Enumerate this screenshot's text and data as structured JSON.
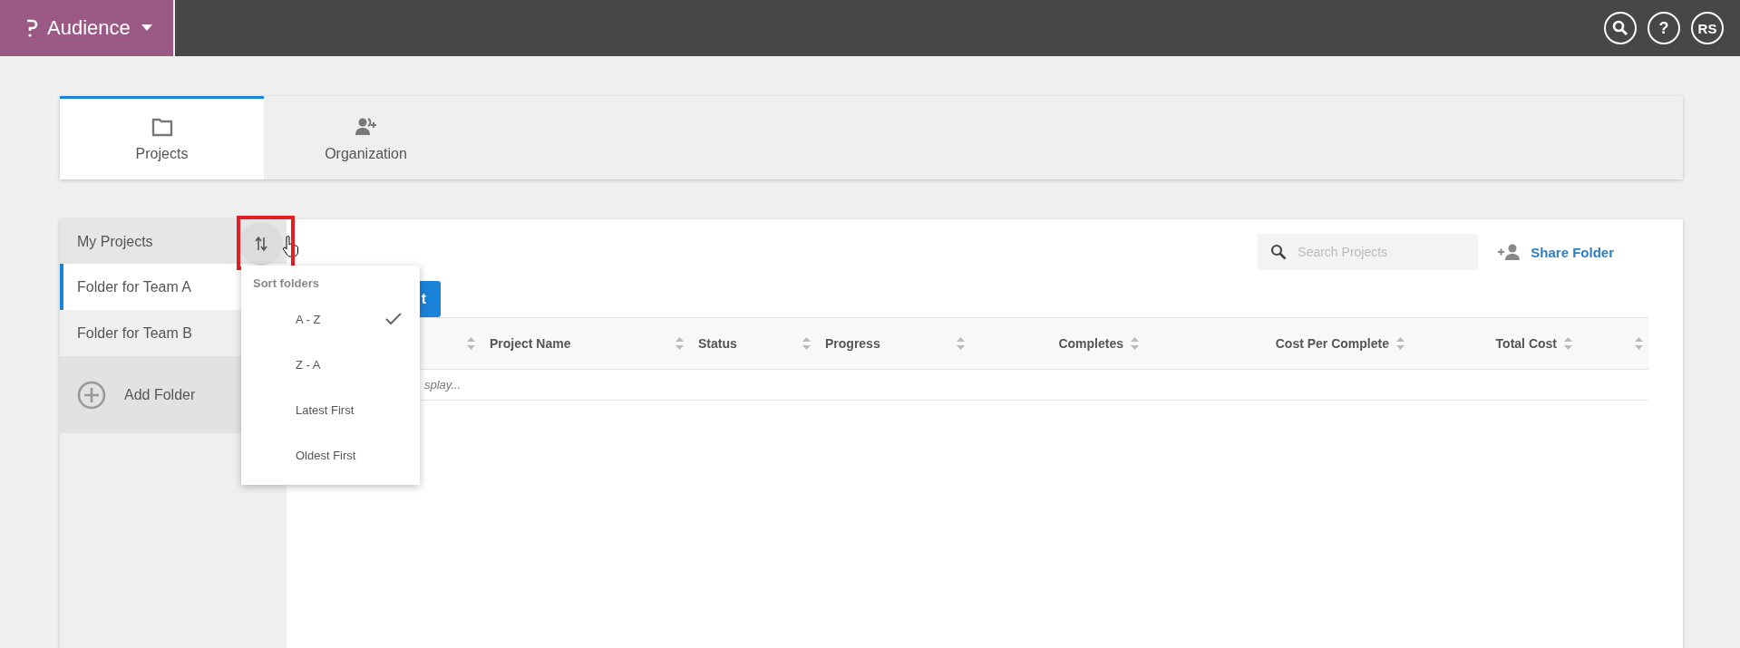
{
  "app": {
    "name": "Audience"
  },
  "header_actions": [
    {
      "kind": "search"
    },
    {
      "kind": "help",
      "label": "?"
    },
    {
      "kind": "avatar",
      "label": "RS"
    }
  ],
  "tabs": [
    {
      "label": "Projects",
      "selected": true
    },
    {
      "label": "Organization",
      "selected": false
    }
  ],
  "sidebar": {
    "header": "My Projects",
    "folders": [
      {
        "label": "Folder for Team A",
        "selected": true
      },
      {
        "label": "Folder for Team B",
        "selected": false
      }
    ],
    "add_folder": "Add Folder"
  },
  "sort_menu": {
    "title": "Sort folders",
    "options": [
      {
        "label": "A - Z",
        "selected": true
      },
      {
        "label": "Z - A",
        "selected": false
      },
      {
        "label": "Latest First",
        "selected": false
      },
      {
        "label": "Oldest First",
        "selected": false
      }
    ]
  },
  "search": {
    "placeholder": "Search Projects"
  },
  "share_button": {
    "label": "Share Folder"
  },
  "new_button": {
    "label": "t"
  },
  "table": {
    "columns": [
      {
        "kind": "blank"
      },
      {
        "kind": "text",
        "label": "Project Name"
      },
      {
        "kind": "text",
        "label": "Status"
      },
      {
        "kind": "text",
        "label": "Progress"
      },
      {
        "kind": "numeric",
        "label": "Completes"
      },
      {
        "kind": "numeric",
        "label": "Cost Per Complete"
      },
      {
        "kind": "numeric",
        "label": "Total Cost"
      },
      {
        "kind": "blank"
      }
    ],
    "rows": [
      {
        "kind": "message",
        "text": "splay..."
      }
    ]
  }
}
